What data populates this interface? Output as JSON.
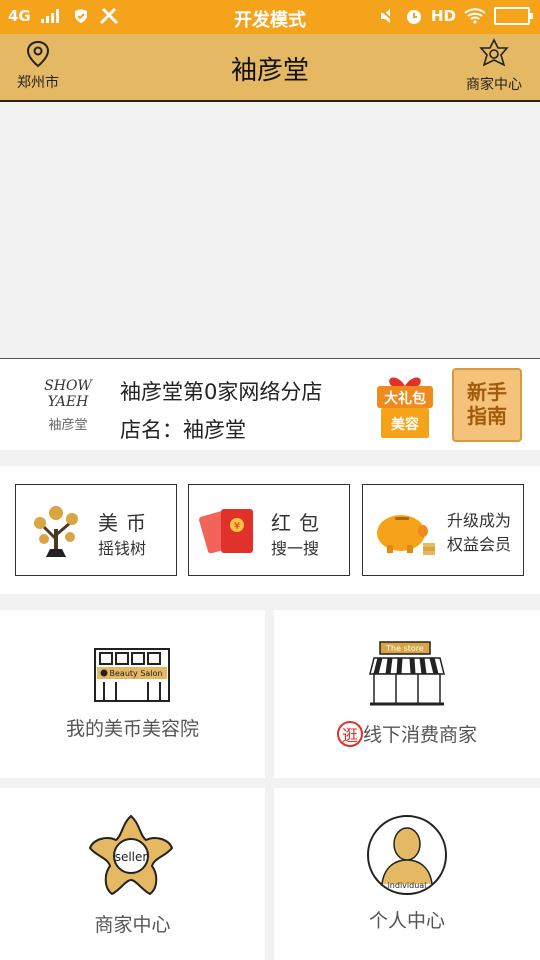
{
  "status_bar": {
    "network": "4G",
    "mode_title": "开发模式",
    "hd": "HD"
  },
  "header": {
    "city": "郑州市",
    "title": "袖彦堂",
    "merchant_center": "商家中心"
  },
  "store": {
    "logo_text": "SHOW YAEH",
    "logo_cn": "袖彦堂",
    "branch_name": "袖彦堂第0家网络分店",
    "store_name": "店名：袖彦堂",
    "gift_label_1": "大礼包",
    "gift_label_2": "美容",
    "guide_line1": "新手",
    "guide_line2": "指南"
  },
  "quick_cards": [
    {
      "line1": "美币",
      "line2": "摇钱树"
    },
    {
      "line1": "红包",
      "line2": "搜一搜"
    },
    {
      "line1": "升级成为",
      "line2": "权益会员"
    }
  ],
  "tiles": {
    "beauty_salon": {
      "label": "我的美币美容院",
      "sign": "Beauty Salon"
    },
    "offline_store": {
      "badge": "逛",
      "label": "线下消费商家",
      "sign": "The store"
    },
    "merchant": {
      "label": "商家中心",
      "badge": "seller"
    },
    "personal": {
      "label": "个人中心",
      "badge": "individual"
    }
  },
  "colors": {
    "status_bar": "#F5A31A",
    "header": "#E5B963",
    "accent_red": "#E0322B",
    "gold": "#E5B963"
  }
}
